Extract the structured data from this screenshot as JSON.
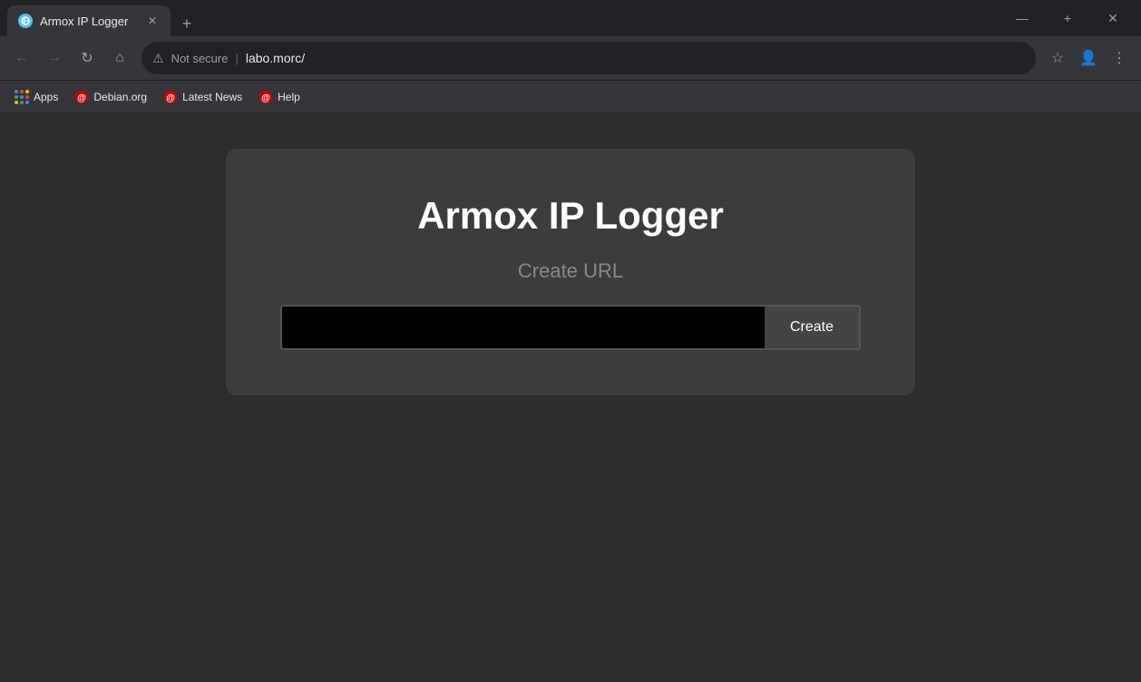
{
  "browser": {
    "tab": {
      "favicon_color": "#4fc3f7",
      "title": "Armox IP Logger",
      "close_label": "✕"
    },
    "new_tab_label": "+",
    "window_controls": {
      "minimize": "—",
      "maximize": "+",
      "close": "✕"
    },
    "nav": {
      "back_arrow": "←",
      "forward_arrow": "→",
      "refresh": "↻",
      "home": "⌂",
      "lock_icon": "⚠",
      "not_secure": "Not secure",
      "separator": "|",
      "url": "labo.morc/",
      "star": "☆",
      "profile": "👤",
      "menu": "⋮"
    },
    "bookmarks": [
      {
        "id": "apps",
        "label": "Apps",
        "type": "apps"
      },
      {
        "id": "debian",
        "label": "Debian.org",
        "type": "favicon",
        "color": "#cc0000"
      },
      {
        "id": "latest-news",
        "label": "Latest News",
        "type": "favicon",
        "color": "#cc0000"
      },
      {
        "id": "help",
        "label": "Help",
        "type": "favicon",
        "color": "#cc0000"
      }
    ]
  },
  "page": {
    "card": {
      "title": "Armox IP Logger",
      "subtitle": "Create URL",
      "input_placeholder": "",
      "create_button_label": "Create"
    }
  }
}
